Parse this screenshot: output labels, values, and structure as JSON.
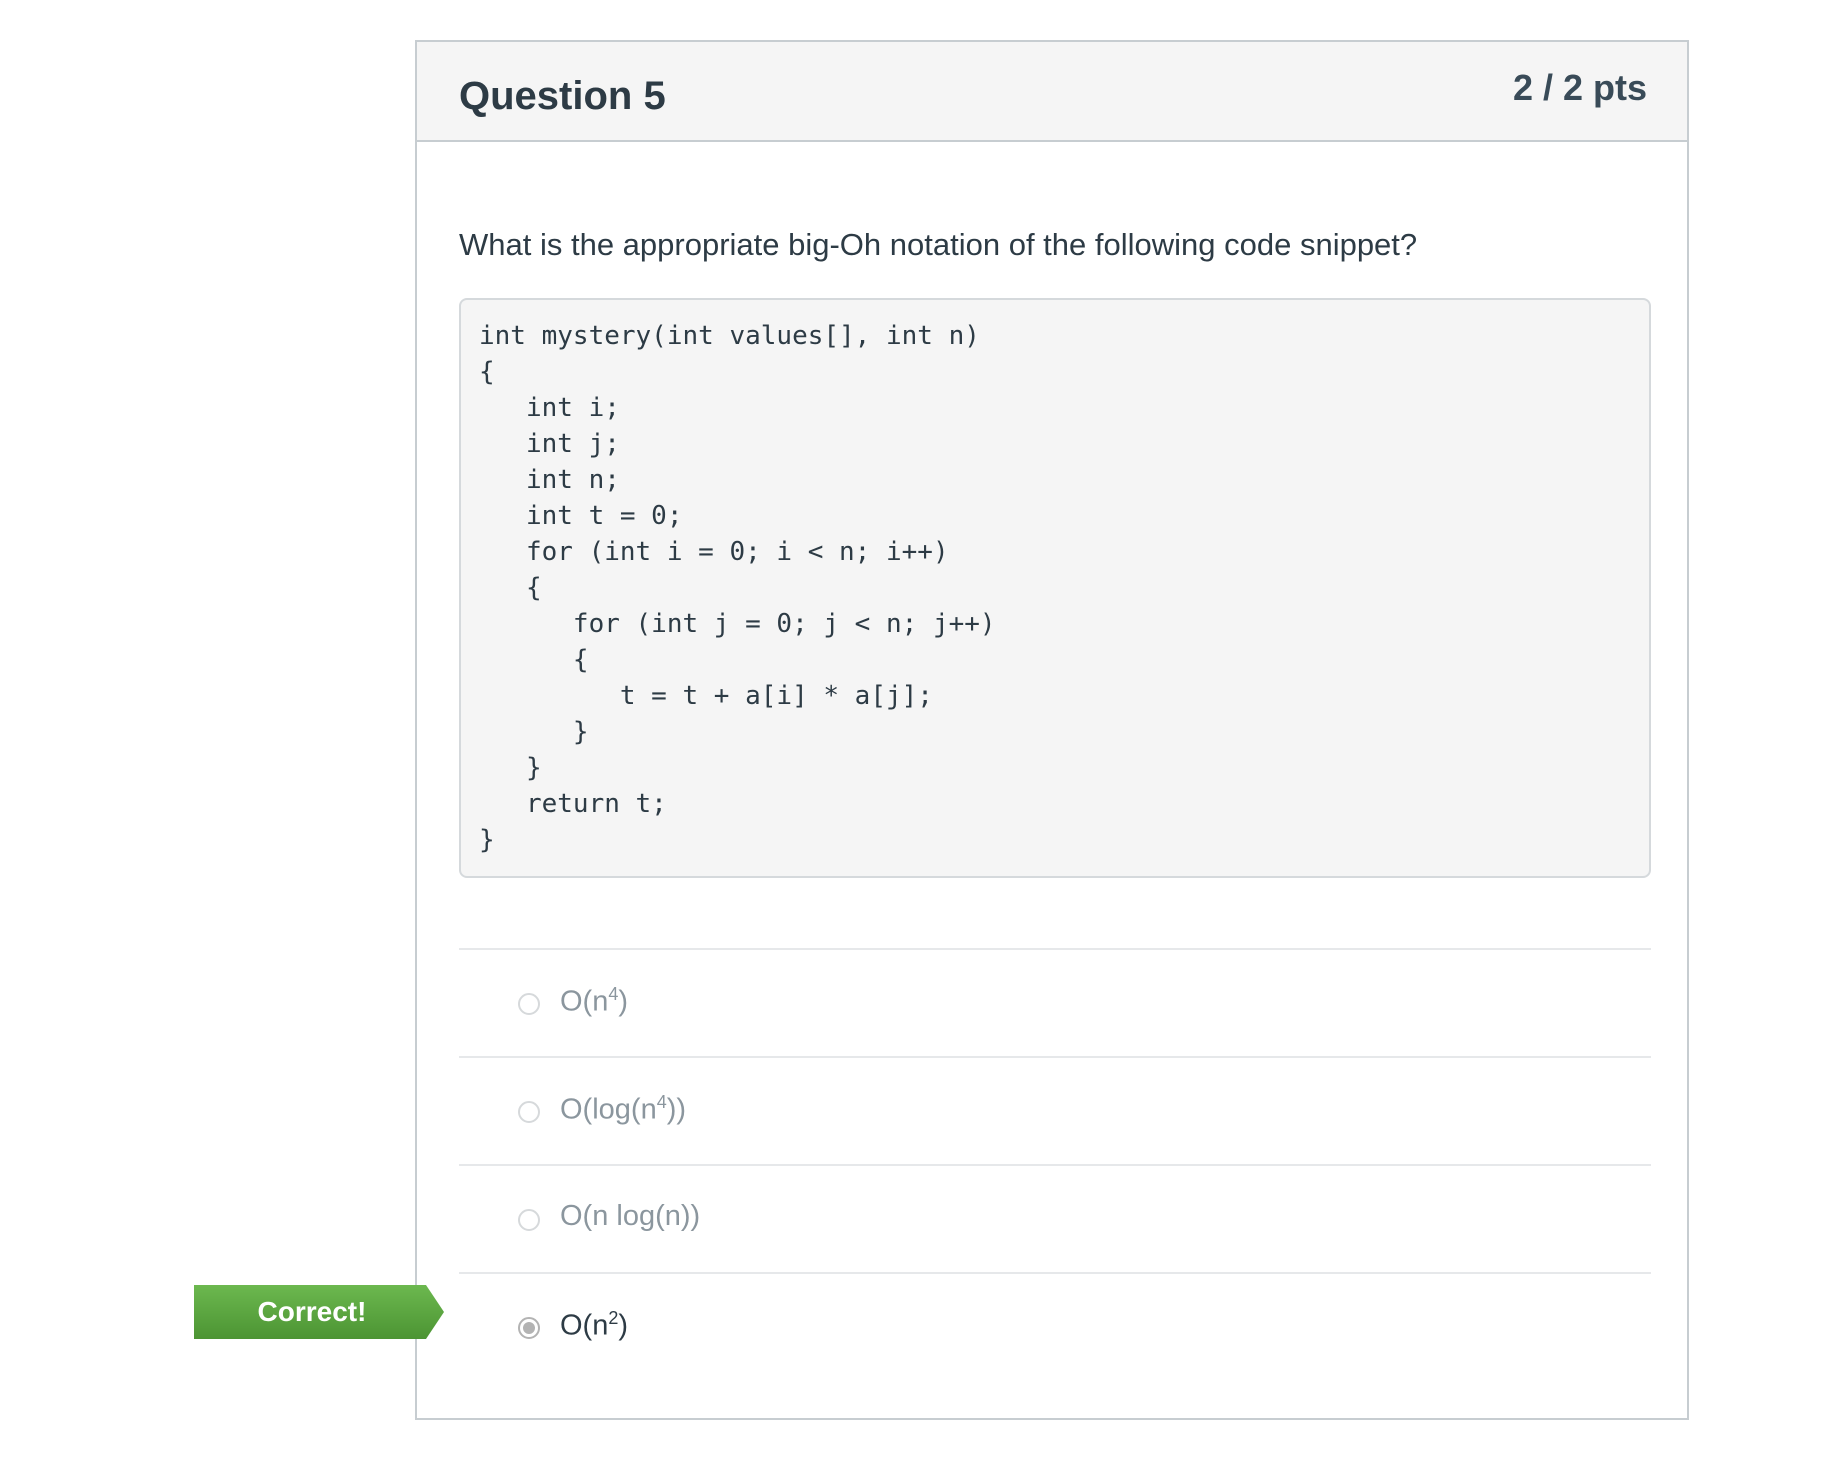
{
  "question": {
    "title": "Question 5",
    "points": "2 / 2 pts",
    "text": "What is the appropriate big-Oh notation of the following code snippet?",
    "code_lines": [
      "int mystery(int values[], int n)",
      "{",
      "   int i;",
      "   int j;",
      "   int n;",
      "   int t = 0;",
      "   for (int i = 0; i < n; i++)",
      "   {",
      "      for (int j = 0; j < n; j++)",
      "      {",
      "         t = t + a[i] * a[j];",
      "      }",
      "   }",
      "   return t;",
      "}"
    ]
  },
  "answers": [
    {
      "base": "O(n",
      "sup": "4",
      "tail": ")",
      "selected": false
    },
    {
      "base": "O(log(n",
      "sup": "4",
      "tail": "))",
      "selected": false
    },
    {
      "base": "O(n log(n))",
      "sup": "",
      "tail": "",
      "selected": false
    },
    {
      "base": "O(n",
      "sup": "2",
      "tail": ")",
      "selected": true
    }
  ],
  "feedback": {
    "label": "Correct!",
    "color": "#5aa340"
  },
  "colors": {
    "border": "#c7cdd1",
    "header_bg": "#f5f5f5",
    "code_bg": "#f5f5f5",
    "text": "#2d3b45",
    "muted_text": "#8b969e"
  }
}
